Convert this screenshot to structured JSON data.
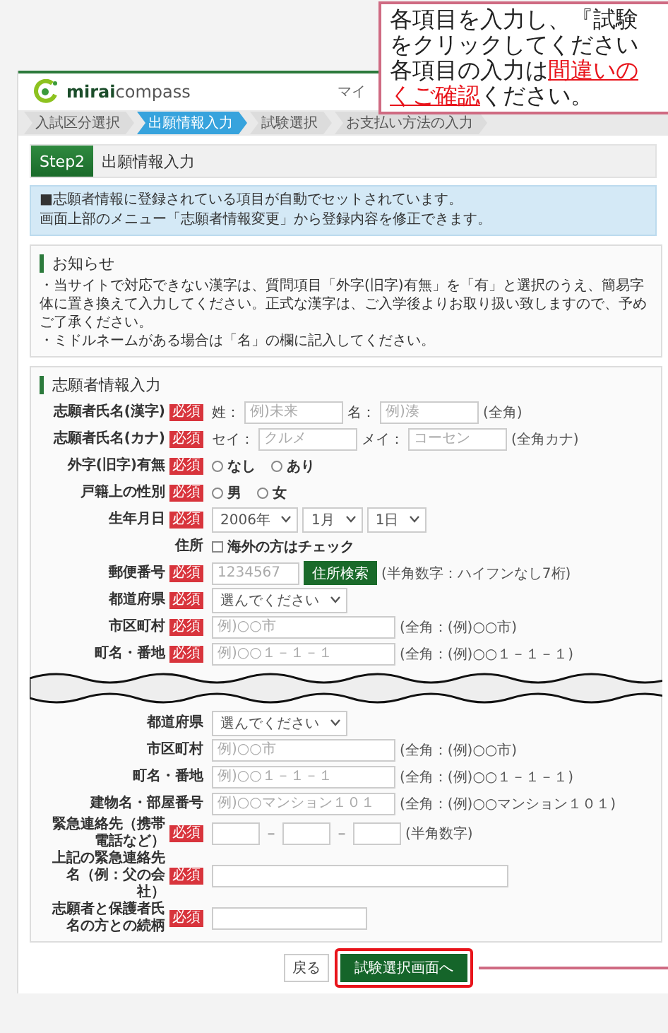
{
  "callout": {
    "lines": [
      "各項目を入力し、『試験",
      "をクリックしてください",
      "各項目の入力は**間違いの**",
      "**くご確認**ください。"
    ]
  },
  "header": {
    "logo": "**mirai**compass",
    "menu_text": "マイ"
  },
  "steps": [
    {
      "label": "入試区分選択",
      "selected": false
    },
    {
      "label": "出願情報入力",
      "selected": true
    },
    {
      "label": "試験選択",
      "selected": false
    },
    {
      "label": "お支払い方法の入力",
      "selected": false
    }
  ],
  "step_header": {
    "badge": "Step2",
    "title": "出願情報入力"
  },
  "info": {
    "lines": [
      "■志願者情報に登録されている項目が自動でセットされています。",
      "画面上部のメニュー「志願者情報変更」から登録内容を修正できます。"
    ]
  },
  "notice": {
    "title": "お知らせ",
    "lines": [
      "・当サイトで対応できない漢字は、質問項目「外字(旧字)有無」を「有」と選択のうえ、簡易字体に置き換えて入力してください。正式な漢字は、ご入学後よりお取り扱い致しますので、予めご了承ください。",
      "・ミドルネームがある場合は「名」の欄に記入してください。"
    ]
  },
  "form": {
    "title": "志願者情報入力",
    "rows": [
      {
        "kind": "pair",
        "label": "志願者氏名(漢字)",
        "badge": "必須",
        "fields": [
          {
            "prefix": "姓：",
            "placeholder": "例)未来"
          },
          {
            "prefix": "名：",
            "placeholder": "例)湊"
          }
        ],
        "hint": "(全角)"
      },
      {
        "kind": "pair",
        "label": "志願者氏名(カナ)",
        "badge": "必須",
        "fields": [
          {
            "prefix": "セイ：",
            "placeholder": "クルメ"
          },
          {
            "prefix": "メイ：",
            "placeholder": "コーセン"
          }
        ],
        "hint": "(全角カナ)"
      },
      {
        "kind": "radio",
        "label": "外字(旧字)有無",
        "badge": "必須",
        "options": [
          {
            "label": "なし",
            "selected": false
          },
          {
            "label": "あり",
            "selected": false
          }
        ]
      },
      {
        "kind": "radio",
        "label": "戸籍上の性別",
        "badge": "必須",
        "options": [
          {
            "label": "男",
            "selected": false
          },
          {
            "label": "女",
            "selected": false
          }
        ]
      },
      {
        "kind": "date",
        "label": "生年月日",
        "badge": "必須",
        "selects": [
          "2006年",
          "1月",
          "1日"
        ]
      },
      {
        "kind": "checkbox",
        "label": "住所",
        "option": {
          "label": "海外の方はチェック",
          "checked": false
        }
      },
      {
        "kind": "zip",
        "label": "郵便番号",
        "badge": "必須",
        "placeholder": "1234567",
        "button": "住所検索",
        "hint": "(半角数字：ハイフンなし7桁)"
      },
      {
        "kind": "select",
        "label": "都道府県",
        "badge": "必須",
        "value": "選んでください"
      },
      {
        "kind": "text",
        "label": "市区町村",
        "badge": "必須",
        "placeholder": "例)○○市",
        "hint": "(全角：(例)○○市)"
      },
      {
        "kind": "text",
        "label": "町名・番地",
        "badge": "必須",
        "placeholder": "例)○○１－１－１",
        "hint": "(全角：(例)○○１－１－１)"
      }
    ],
    "continued_rows": [
      {
        "kind": "select",
        "label": "都道府県",
        "value": "選んでください"
      },
      {
        "kind": "text",
        "label": "市区町村",
        "placeholder": "例)○○市",
        "hint": "(全角：(例)○○市)"
      },
      {
        "kind": "text",
        "label": "町名・番地",
        "placeholder": "例)○○１－１－１",
        "hint": "(全角：(例)○○１－１－１)"
      },
      {
        "kind": "text",
        "label": "建物名・部屋番号",
        "placeholder": "例)○○マンション１０１",
        "hint": "(全角：(例)○○マンション１０１)"
      },
      {
        "kind": "phone",
        "label": "緊急連絡先（携帯電話など）",
        "badge": "必須",
        "separator": "－",
        "hint": "(半角数字)"
      },
      {
        "kind": "long_text",
        "label": "上記の緊急連絡先名（例：父の会社）",
        "badge": "必須"
      },
      {
        "kind": "short_text",
        "label": "志願者と保護者氏名の方との続柄",
        "badge": "必須"
      }
    ]
  },
  "buttons": [
    {
      "kind": "back",
      "label": "戻る",
      "highlighted": false
    },
    {
      "kind": "next",
      "label": "試験選択画面へ",
      "highlighted": true
    }
  ]
}
